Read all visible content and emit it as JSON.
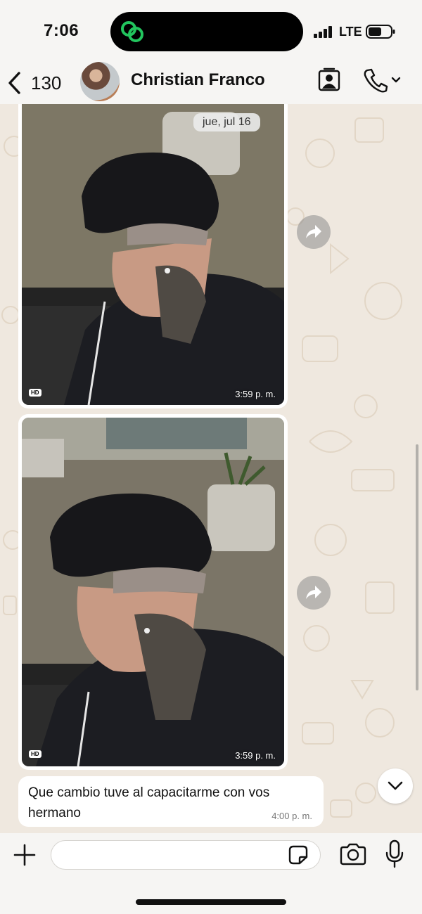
{
  "status_bar": {
    "time": "7:06",
    "network": "LTE",
    "island_icon": "link-rings-icon",
    "accent_color": "#22c55e"
  },
  "header": {
    "back_count": "130",
    "contact_name": "Christian Franco",
    "icons": [
      "chevron-left-icon",
      "contact-card-icon",
      "phone-icon",
      "chevron-down-icon"
    ]
  },
  "chat": {
    "date_label": "jue, jul 16",
    "wallpaper_color": "#efe8df",
    "messages": [
      {
        "type": "image",
        "hd_label": "HD",
        "time": "3:59 p. m."
      },
      {
        "type": "image",
        "hd_label": "HD",
        "time": "3:59 p. m."
      },
      {
        "type": "text",
        "text": "Que cambio tuve al capacitarme con vos hermano",
        "time": "4:00 p. m."
      }
    ]
  },
  "input_bar": {
    "value": "",
    "placeholder": "",
    "icons": [
      "plus-icon",
      "sticker-icon",
      "camera-icon",
      "microphone-icon"
    ]
  }
}
